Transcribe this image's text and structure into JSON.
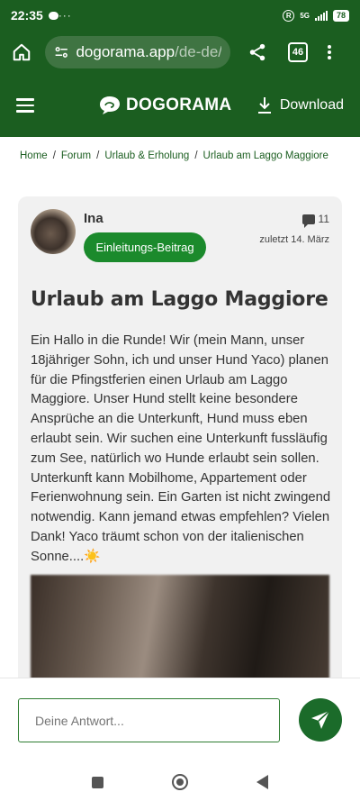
{
  "status_bar": {
    "time": "22:35",
    "battery": "78",
    "network": "5G"
  },
  "browser": {
    "url_main": "dogorama.app",
    "url_path": "/de-de/fo",
    "tab_count": "46"
  },
  "site_header": {
    "logo_text": "DOGORAMA",
    "download_label": "Download"
  },
  "breadcrumb": {
    "items": [
      "Home",
      "Forum",
      "Urlaub & Erholung",
      "Urlaub am Laggo Maggiore"
    ],
    "separator": "/"
  },
  "post": {
    "author": "Ina",
    "badge": "Einleitungs-Beitrag",
    "comment_count": "11",
    "last_activity": "zuletzt 14. März",
    "title": "Urlaub am Laggo Maggiore",
    "body": "Ein Hallo in die Runde! Wir (mein Mann, unser 18jähriger Sohn, ich und unser Hund Yaco) planen für die Pfingstferien einen Urlaub am Laggo Maggiore. Unser Hund stellt keine besondere Ansprüche an die Unterkunft, Hund muss eben erlaubt sein. Wir suchen eine Unterkunft fussläufig zum See, natürlich wo Hunde erlaubt sein sollen. Unterkunft kann Mobilhome, Appartement oder Ferienwohnung sein. Ein Garten ist nicht zwingend notwendig. Kann jemand etwas empfehlen? Vielen Dank! Yaco träumt schon von der italienischen Sonne....☀️"
  },
  "reply": {
    "placeholder": "Deine Antwort..."
  },
  "colors": {
    "brand_green": "#1b5e20",
    "badge_green": "#1b8a2c",
    "send_green": "#1b6b2a"
  }
}
